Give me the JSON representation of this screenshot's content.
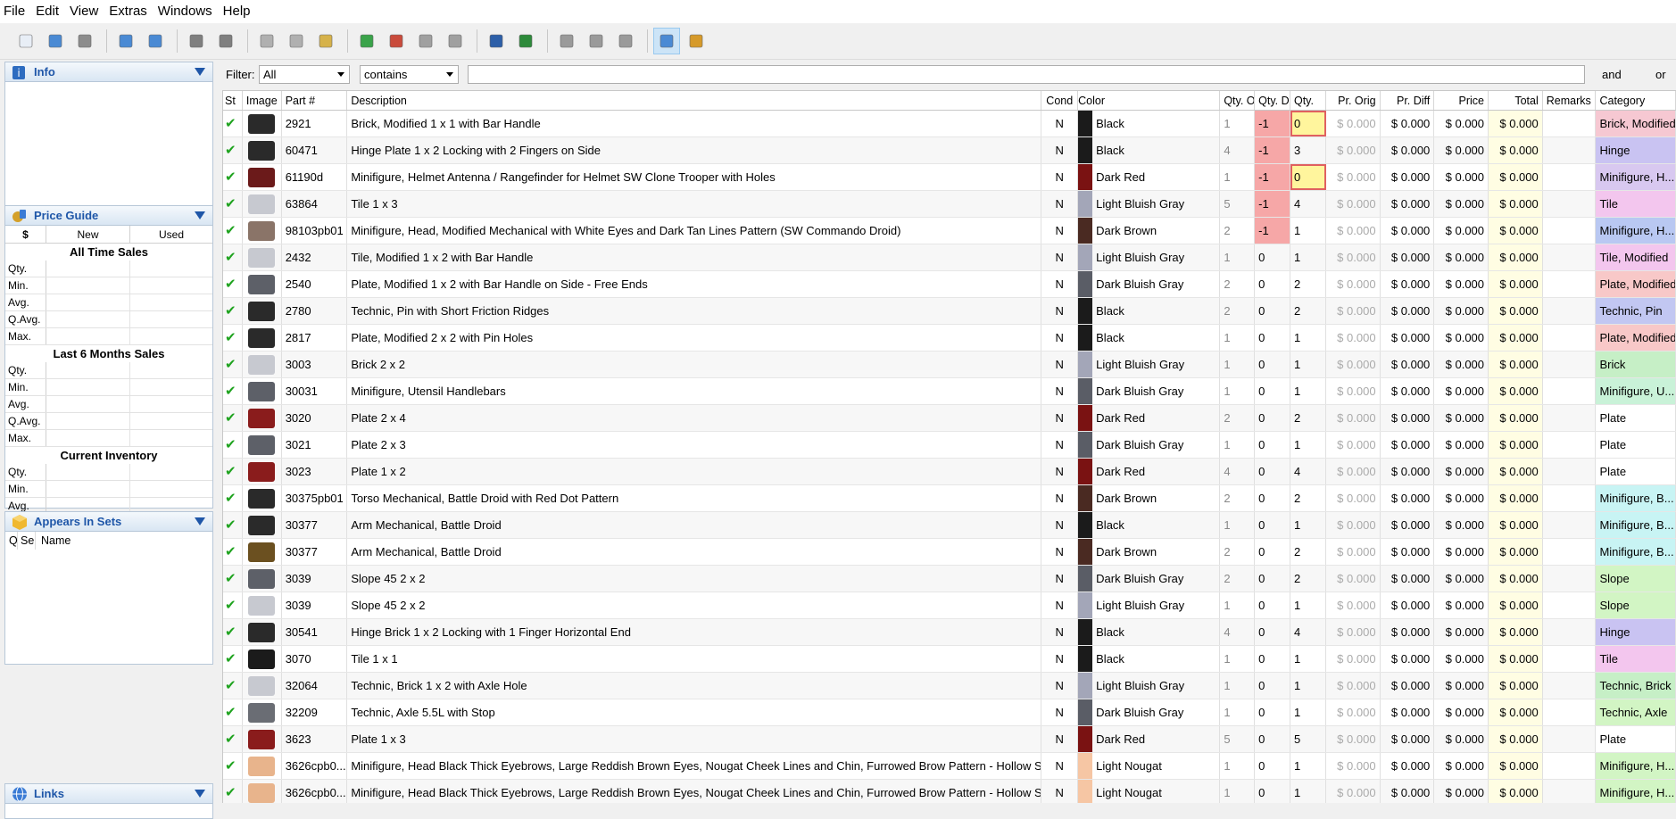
{
  "menu": [
    "File",
    "Edit",
    "View",
    "Extras",
    "Windows",
    "Help"
  ],
  "toolbar": {
    "groups": [
      [
        {
          "icon": "new-doc-icon",
          "color": "#e8eef6"
        },
        {
          "icon": "open-folder-icon",
          "color": "#4a8ad4"
        },
        {
          "icon": "save-icon",
          "color": "#8c8c8c"
        }
      ],
      [
        {
          "icon": "import-icon",
          "color": "#4a8ad4"
        },
        {
          "icon": "export-icon",
          "color": "#4a8ad4"
        }
      ],
      [
        {
          "icon": "undo-icon",
          "color": "#7f7f7f"
        },
        {
          "icon": "redo-icon",
          "color": "#7f7f7f"
        }
      ],
      [
        {
          "icon": "cut-icon",
          "color": "#b0b0b0"
        },
        {
          "icon": "copy-icon",
          "color": "#b0b0b0"
        },
        {
          "icon": "paste-icon",
          "color": "#d6b24a"
        }
      ],
      [
        {
          "icon": "add-item-icon",
          "color": "#3aa34a"
        },
        {
          "icon": "subtract-item-icon",
          "color": "#c94b3b"
        },
        {
          "icon": "merge-item-icon",
          "color": "#a0a0a0"
        },
        {
          "icon": "split-item-icon",
          "color": "#a0a0a0"
        }
      ],
      [
        {
          "icon": "price-to-guide-icon",
          "color": "#2d5fa8"
        },
        {
          "icon": "add-price-icon",
          "color": "#2d8a3a"
        }
      ],
      [
        {
          "icon": "edit-multi-icon",
          "color": "#9a9a9a"
        },
        {
          "icon": "edit-single-icon",
          "color": "#9a9a9a"
        },
        {
          "icon": "info-circle-icon",
          "color": "#9a9a9a"
        }
      ],
      [
        {
          "icon": "view-mode-icon",
          "color": "#4a8ad4"
        },
        {
          "icon": "filter-view-icon",
          "color": "#d69a2a"
        }
      ]
    ]
  },
  "panels": {
    "info": {
      "title": "Info"
    },
    "price_guide": {
      "title": "Price Guide",
      "currency": "$",
      "col_new": "New",
      "col_used": "Used",
      "sections": [
        {
          "title": "All Time Sales",
          "rows": [
            "Qty.",
            "Min.",
            "Avg.",
            "Q.Avg.",
            "Max."
          ]
        },
        {
          "title": "Last 6 Months Sales",
          "rows": [
            "Qty.",
            "Min.",
            "Avg.",
            "Q.Avg.",
            "Max."
          ]
        },
        {
          "title": "Current Inventory",
          "rows": [
            "Qty.",
            "Min.",
            "Avg.",
            "Q.Avg.",
            "Max."
          ]
        }
      ]
    },
    "sets": {
      "title": "Appears In Sets",
      "col_q": "Q",
      "col_s": "Se",
      "col_name": "Name"
    },
    "links": {
      "title": "Links"
    }
  },
  "filter": {
    "label": "Filter:",
    "field": "All",
    "op": "contains",
    "and": "and",
    "or": "or"
  },
  "columns": [
    "St",
    "Image",
    "Part #",
    "Description",
    "Cond",
    "Color",
    "Qty. O",
    "Qty. D",
    "Qty.",
    "Pr. Orig",
    "Pr. Diff",
    "Price",
    "Total",
    "Remarks",
    "Category"
  ],
  "rows": [
    {
      "part": "2921",
      "desc": "Brick, Modified 1 x 1 with Bar Handle",
      "cond": "N",
      "color": "Black",
      "swatch": "#1b1b1b",
      "qo": "1",
      "qd": "-1",
      "q": "0",
      "po": "$ 0.000",
      "pd": "$ 0.000",
      "pr": "$ 0.000",
      "tot": "$ 0.000",
      "cat": "Brick, Modified",
      "catbg": "#f6c8d2",
      "img": "#2a2a2a",
      "warn": true
    },
    {
      "part": "60471",
      "desc": "Hinge Plate 1 x 2 Locking with 2 Fingers on Side",
      "cond": "N",
      "color": "Black",
      "swatch": "#1b1b1b",
      "qo": "4",
      "qd": "-1",
      "q": "3",
      "po": "$ 0.000",
      "pd": "$ 0.000",
      "pr": "$ 0.000",
      "tot": "$ 0.000",
      "cat": "Hinge",
      "catbg": "#c9c3f2",
      "img": "#2a2a2a",
      "warn": false
    },
    {
      "part": "61190d",
      "desc": "Minifigure, Helmet Antenna / Rangefinder for Helmet SW Clone Trooper with Holes",
      "cond": "N",
      "color": "Dark Red",
      "swatch": "#7a1212",
      "qo": "1",
      "qd": "-1",
      "q": "0",
      "po": "$ 0.000",
      "pd": "$ 0.000",
      "pr": "$ 0.000",
      "tot": "$ 0.000",
      "cat": "Minifigure, H...",
      "catbg": "#d8c8f0",
      "img": "#6b1a1a",
      "warn": true
    },
    {
      "part": "63864",
      "desc": "Tile 1 x 3",
      "cond": "N",
      "color": "Light Bluish Gray",
      "swatch": "#a3a6b8",
      "qo": "5",
      "qd": "-1",
      "q": "4",
      "po": "$ 0.000",
      "pd": "$ 0.000",
      "pr": "$ 0.000",
      "tot": "$ 0.000",
      "cat": "Tile",
      "catbg": "#f3c6ee",
      "img": "#c7c9d0",
      "warn": false
    },
    {
      "part": "98103pb01",
      "desc": "Minifigure, Head, Modified Mechanical with White Eyes and Dark Tan Lines Pattern (SW Commando Droid)",
      "cond": "N",
      "color": "Dark Brown",
      "swatch": "#4a2a22",
      "qo": "2",
      "qd": "-1",
      "q": "1",
      "po": "$ 0.000",
      "pd": "$ 0.000",
      "pr": "$ 0.000",
      "tot": "$ 0.000",
      "cat": "Minifigure, H...",
      "catbg": "#b9c8f2",
      "img": "#8a7468",
      "warn": false
    },
    {
      "part": "2432",
      "desc": "Tile, Modified 1 x 2 with Bar Handle",
      "cond": "N",
      "color": "Light Bluish Gray",
      "swatch": "#a3a6b8",
      "qo": "1",
      "qd": "0",
      "q": "1",
      "po": "$ 0.000",
      "pd": "$ 0.000",
      "pr": "$ 0.000",
      "tot": "$ 0.000",
      "cat": "Tile, Modified",
      "catbg": "#f3c6ee",
      "img": "#c7c9d0",
      "warn": false
    },
    {
      "part": "2540",
      "desc": "Plate, Modified 1 x 2 with Bar Handle on Side - Free Ends",
      "cond": "N",
      "color": "Dark Bluish Gray",
      "swatch": "#5a5d66",
      "qo": "2",
      "qd": "0",
      "q": "2",
      "po": "$ 0.000",
      "pd": "$ 0.000",
      "pr": "$ 0.000",
      "tot": "$ 0.000",
      "cat": "Plate, Modified",
      "catbg": "#f8c8c8",
      "img": "#5d6068",
      "warn": false
    },
    {
      "part": "2780",
      "desc": "Technic, Pin with Short Friction Ridges",
      "cond": "N",
      "color": "Black",
      "swatch": "#1b1b1b",
      "qo": "2",
      "qd": "0",
      "q": "2",
      "po": "$ 0.000",
      "pd": "$ 0.000",
      "pr": "$ 0.000",
      "tot": "$ 0.000",
      "cat": "Technic, Pin",
      "catbg": "#c2c7f2",
      "img": "#2a2a2a",
      "warn": false
    },
    {
      "part": "2817",
      "desc": "Plate, Modified 2 x 2 with Pin Holes",
      "cond": "N",
      "color": "Black",
      "swatch": "#1b1b1b",
      "qo": "1",
      "qd": "0",
      "q": "1",
      "po": "$ 0.000",
      "pd": "$ 0.000",
      "pr": "$ 0.000",
      "tot": "$ 0.000",
      "cat": "Plate, Modified",
      "catbg": "#f8c8c8",
      "img": "#2a2a2a",
      "warn": false
    },
    {
      "part": "3003",
      "desc": "Brick 2 x 2",
      "cond": "N",
      "color": "Light Bluish Gray",
      "swatch": "#a3a6b8",
      "qo": "1",
      "qd": "0",
      "q": "1",
      "po": "$ 0.000",
      "pd": "$ 0.000",
      "pr": "$ 0.000",
      "tot": "$ 0.000",
      "cat": "Brick",
      "catbg": "#c6efc6",
      "img": "#c7c9d0",
      "warn": false
    },
    {
      "part": "30031",
      "desc": "Minifigure, Utensil Handlebars",
      "cond": "N",
      "color": "Dark Bluish Gray",
      "swatch": "#5a5d66",
      "qo": "1",
      "qd": "0",
      "q": "1",
      "po": "$ 0.000",
      "pd": "$ 0.000",
      "pr": "$ 0.000",
      "tot": "$ 0.000",
      "cat": "Minifigure, U...",
      "catbg": "#c9f2d8",
      "img": "#5d6068",
      "warn": false
    },
    {
      "part": "3020",
      "desc": "Plate 2 x 4",
      "cond": "N",
      "color": "Dark Red",
      "swatch": "#7a1212",
      "qo": "2",
      "qd": "0",
      "q": "2",
      "po": "$ 0.000",
      "pd": "$ 0.000",
      "pr": "$ 0.000",
      "tot": "$ 0.000",
      "cat": "Plate",
      "catbg": "#ffffff",
      "img": "#8a1c1c",
      "warn": false
    },
    {
      "part": "3021",
      "desc": "Plate 2 x 3",
      "cond": "N",
      "color": "Dark Bluish Gray",
      "swatch": "#5a5d66",
      "qo": "1",
      "qd": "0",
      "q": "1",
      "po": "$ 0.000",
      "pd": "$ 0.000",
      "pr": "$ 0.000",
      "tot": "$ 0.000",
      "cat": "Plate",
      "catbg": "#ffffff",
      "img": "#5d6068",
      "warn": false
    },
    {
      "part": "3023",
      "desc": "Plate 1 x 2",
      "cond": "N",
      "color": "Dark Red",
      "swatch": "#7a1212",
      "qo": "4",
      "qd": "0",
      "q": "4",
      "po": "$ 0.000",
      "pd": "$ 0.000",
      "pr": "$ 0.000",
      "tot": "$ 0.000",
      "cat": "Plate",
      "catbg": "#ffffff",
      "img": "#8a1c1c",
      "warn": false
    },
    {
      "part": "30375pb01",
      "desc": "Torso Mechanical, Battle Droid with Red Dot Pattern",
      "cond": "N",
      "color": "Dark Brown",
      "swatch": "#4a2a22",
      "qo": "2",
      "qd": "0",
      "q": "2",
      "po": "$ 0.000",
      "pd": "$ 0.000",
      "pr": "$ 0.000",
      "tot": "$ 0.000",
      "cat": "Minifigure, B...",
      "catbg": "#c8f4f4",
      "img": "#2a2a2a",
      "warn": false
    },
    {
      "part": "30377",
      "desc": "Arm Mechanical, Battle Droid",
      "cond": "N",
      "color": "Black",
      "swatch": "#1b1b1b",
      "qo": "1",
      "qd": "0",
      "q": "1",
      "po": "$ 0.000",
      "pd": "$ 0.000",
      "pr": "$ 0.000",
      "tot": "$ 0.000",
      "cat": "Minifigure, B...",
      "catbg": "#c8f4f4",
      "img": "#2a2a2a",
      "warn": false
    },
    {
      "part": "30377",
      "desc": "Arm Mechanical, Battle Droid",
      "cond": "N",
      "color": "Dark Brown",
      "swatch": "#4a2a22",
      "qo": "2",
      "qd": "0",
      "q": "2",
      "po": "$ 0.000",
      "pd": "$ 0.000",
      "pr": "$ 0.000",
      "tot": "$ 0.000",
      "cat": "Minifigure, B...",
      "catbg": "#c8f4f4",
      "img": "#6b5020",
      "warn": false
    },
    {
      "part": "3039",
      "desc": "Slope 45 2 x 2",
      "cond": "N",
      "color": "Dark Bluish Gray",
      "swatch": "#5a5d66",
      "qo": "2",
      "qd": "0",
      "q": "2",
      "po": "$ 0.000",
      "pd": "$ 0.000",
      "pr": "$ 0.000",
      "tot": "$ 0.000",
      "cat": "Slope",
      "catbg": "#d2f5c4",
      "img": "#5d6068",
      "warn": false
    },
    {
      "part": "3039",
      "desc": "Slope 45 2 x 2",
      "cond": "N",
      "color": "Light Bluish Gray",
      "swatch": "#a3a6b8",
      "qo": "1",
      "qd": "0",
      "q": "1",
      "po": "$ 0.000",
      "pd": "$ 0.000",
      "pr": "$ 0.000",
      "tot": "$ 0.000",
      "cat": "Slope",
      "catbg": "#d2f5c4",
      "img": "#c7c9d0",
      "warn": false
    },
    {
      "part": "30541",
      "desc": "Hinge Brick 1 x 2 Locking with 1 Finger Horizontal End",
      "cond": "N",
      "color": "Black",
      "swatch": "#1b1b1b",
      "qo": "4",
      "qd": "0",
      "q": "4",
      "po": "$ 0.000",
      "pd": "$ 0.000",
      "pr": "$ 0.000",
      "tot": "$ 0.000",
      "cat": "Hinge",
      "catbg": "#c9c3f2",
      "img": "#2a2a2a",
      "warn": false
    },
    {
      "part": "3070",
      "desc": "Tile 1 x 1",
      "cond": "N",
      "color": "Black",
      "swatch": "#1b1b1b",
      "qo": "1",
      "qd": "0",
      "q": "1",
      "po": "$ 0.000",
      "pd": "$ 0.000",
      "pr": "$ 0.000",
      "tot": "$ 0.000",
      "cat": "Tile",
      "catbg": "#f3c6ee",
      "img": "#1b1b1b",
      "warn": false
    },
    {
      "part": "32064",
      "desc": "Technic, Brick 1 x 2 with Axle Hole",
      "cond": "N",
      "color": "Light Bluish Gray",
      "swatch": "#a3a6b8",
      "qo": "1",
      "qd": "0",
      "q": "1",
      "po": "$ 0.000",
      "pd": "$ 0.000",
      "pr": "$ 0.000",
      "tot": "$ 0.000",
      "cat": "Technic, Brick",
      "catbg": "#c6efc6",
      "img": "#c7c9d0",
      "warn": false
    },
    {
      "part": "32209",
      "desc": "Technic, Axle  5.5L with Stop",
      "cond": "N",
      "color": "Dark Bluish Gray",
      "swatch": "#5a5d66",
      "qo": "1",
      "qd": "0",
      "q": "1",
      "po": "$ 0.000",
      "pd": "$ 0.000",
      "pr": "$ 0.000",
      "tot": "$ 0.000",
      "cat": "Technic, Axle",
      "catbg": "#d2f5c4",
      "img": "#6a6d74",
      "warn": false
    },
    {
      "part": "3623",
      "desc": "Plate 1 x 3",
      "cond": "N",
      "color": "Dark Red",
      "swatch": "#7a1212",
      "qo": "5",
      "qd": "0",
      "q": "5",
      "po": "$ 0.000",
      "pd": "$ 0.000",
      "pr": "$ 0.000",
      "tot": "$ 0.000",
      "cat": "Plate",
      "catbg": "#ffffff",
      "img": "#8a1c1c",
      "warn": false
    },
    {
      "part": "3626cpb0...",
      "desc": "Minifigure, Head Black Thick Eyebrows, Large Reddish Brown Eyes, Nougat Cheek Lines and Chin, Furrowed Brow Pattern - Hollow Stud",
      "cond": "N",
      "color": "Light Nougat",
      "swatch": "#f6c6a4",
      "qo": "1",
      "qd": "0",
      "q": "1",
      "po": "$ 0.000",
      "pd": "$ 0.000",
      "pr": "$ 0.000",
      "tot": "$ 0.000",
      "cat": "Minifigure, H...",
      "catbg": "#d2f5c4",
      "img": "#e8b48c",
      "warn": false
    },
    {
      "part": "3626cpb0...",
      "desc": "Minifigure, Head Black Thick Eyebrows, Large Reddish Brown Eyes, Nougat Cheek Lines and Chin, Furrowed Brow Pattern - Hollow Stud",
      "cond": "N",
      "color": "Light Nougat",
      "swatch": "#f6c6a4",
      "qo": "1",
      "qd": "0",
      "q": "1",
      "po": "$ 0.000",
      "pd": "$ 0.000",
      "pr": "$ 0.000",
      "tot": "$ 0.000",
      "cat": "Minifigure, H...",
      "catbg": "#d2f5c4",
      "img": "#e8b48c",
      "warn": false
    }
  ]
}
